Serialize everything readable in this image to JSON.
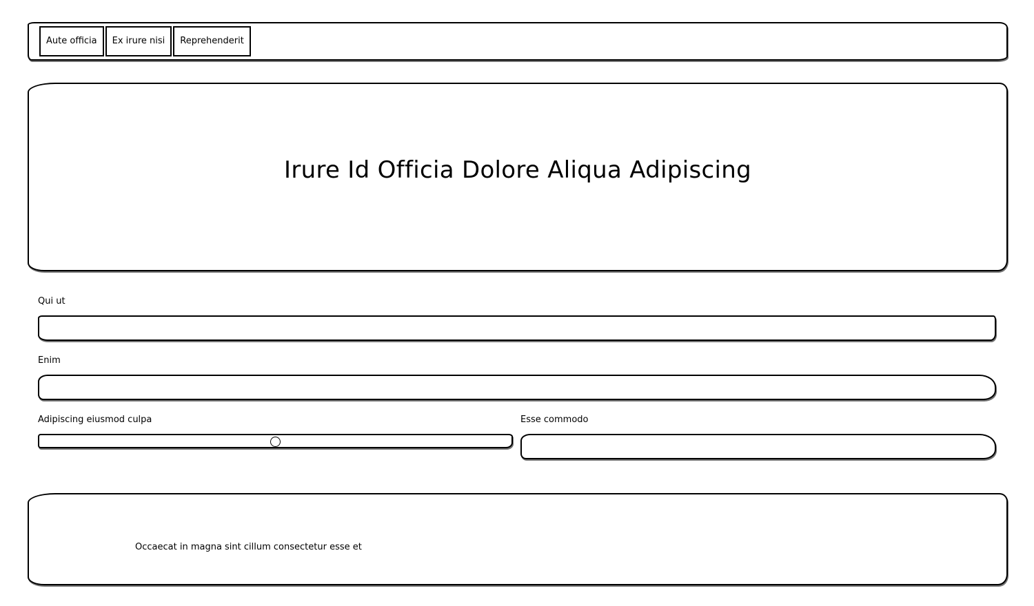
{
  "nav": {
    "tabs": [
      {
        "label": "Aute officia"
      },
      {
        "label": "Ex irure nisi"
      },
      {
        "label": "Reprehenderit"
      }
    ]
  },
  "hero": {
    "title": "Irure Id Officia Dolore Aliqua Adipiscing"
  },
  "form": {
    "qui_ut": {
      "label": "Qui ut",
      "value": ""
    },
    "enim": {
      "label": "Enim",
      "value": ""
    },
    "slider": {
      "label": "Adipiscing eiusmod culpa",
      "value_fraction": 0.5
    },
    "esse_commodo": {
      "label": "Esse commodo",
      "value": ""
    }
  },
  "footer": {
    "text": "Occaecat in magna sint cillum consectetur esse et"
  }
}
